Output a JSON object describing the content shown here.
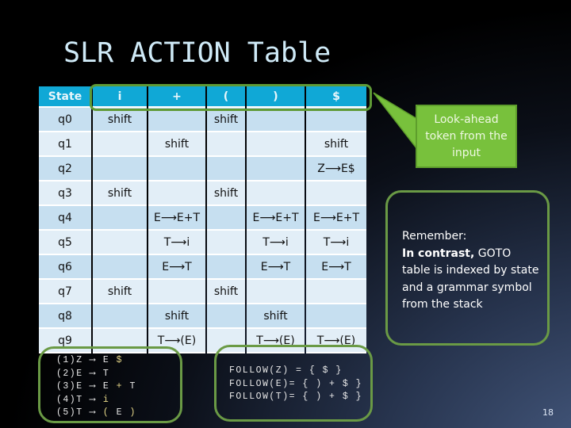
{
  "slide": {
    "title": "SLR ACTION Table",
    "page_number": "18"
  },
  "table": {
    "headers": [
      "State",
      "i",
      "+",
      "(",
      ")",
      "$"
    ],
    "rows": [
      {
        "state": "q0",
        "cells": [
          "shift",
          "",
          "shift",
          "",
          ""
        ]
      },
      {
        "state": "q1",
        "cells": [
          "",
          "shift",
          "",
          "",
          "shift"
        ]
      },
      {
        "state": "q2",
        "cells": [
          "",
          "",
          "",
          "",
          "Z⟶E$"
        ]
      },
      {
        "state": "q3",
        "cells": [
          "shift",
          "",
          "shift",
          "",
          ""
        ]
      },
      {
        "state": "q4",
        "cells": [
          "",
          "E⟶E+T",
          "",
          "E⟶E+T",
          "E⟶E+T"
        ]
      },
      {
        "state": "q5",
        "cells": [
          "",
          "T⟶i",
          "",
          "T⟶i",
          "T⟶i"
        ]
      },
      {
        "state": "q6",
        "cells": [
          "",
          "E⟶T",
          "",
          "E⟶T",
          "E⟶T"
        ]
      },
      {
        "state": "q7",
        "cells": [
          "shift",
          "",
          "shift",
          "",
          ""
        ]
      },
      {
        "state": "q8",
        "cells": [
          "",
          "shift",
          "",
          "shift",
          ""
        ]
      },
      {
        "state": "q9",
        "cells": [
          "",
          "T⟶(E)",
          "",
          "T⟶(E)",
          "T⟶(E)"
        ]
      }
    ]
  },
  "callout": {
    "text": "Look-ahead token from the input"
  },
  "remember": {
    "heading": "Remember:",
    "bold_lead": "In contrast,",
    "body": " GOTO table is indexed by state and a grammar symbol from the stack"
  },
  "grammar": [
    {
      "num": "(1)",
      "lhs": "Z",
      "arrow": "⟶",
      "rhs": [
        {
          "t": "E",
          "y": false
        },
        {
          "t": "$",
          "y": true
        }
      ]
    },
    {
      "num": "(2)",
      "lhs": "E",
      "arrow": "⟶",
      "rhs": [
        {
          "t": "T",
          "y": false
        }
      ]
    },
    {
      "num": "(3)",
      "lhs": "E",
      "arrow": "⟶",
      "rhs": [
        {
          "t": "E",
          "y": false
        },
        {
          "t": "+",
          "y": true
        },
        {
          "t": "T",
          "y": false
        }
      ]
    },
    {
      "num": "(4)",
      "lhs": "T",
      "arrow": "⟶",
      "rhs": [
        {
          "t": "i",
          "y": true
        }
      ]
    },
    {
      "num": "(5)",
      "lhs": "T",
      "arrow": "⟶",
      "rhs": [
        {
          "t": "(",
          "y": true
        },
        {
          "t": "E",
          "y": false
        },
        {
          "t": ")",
          "y": true
        }
      ]
    }
  ],
  "follow": [
    "FOLLOW(Z) = { $ }",
    "FOLLOW(E)= { ) + $ }",
    "FOLLOW(T)= { ) + $ }"
  ],
  "colors": {
    "header_bg": "#10a8d6",
    "row_light": "#e2eef7",
    "row_dark": "#c6dff0",
    "highlight_border": "#5f9a36",
    "callout_bg": "#78c13c",
    "box_border": "#6a9a45"
  }
}
